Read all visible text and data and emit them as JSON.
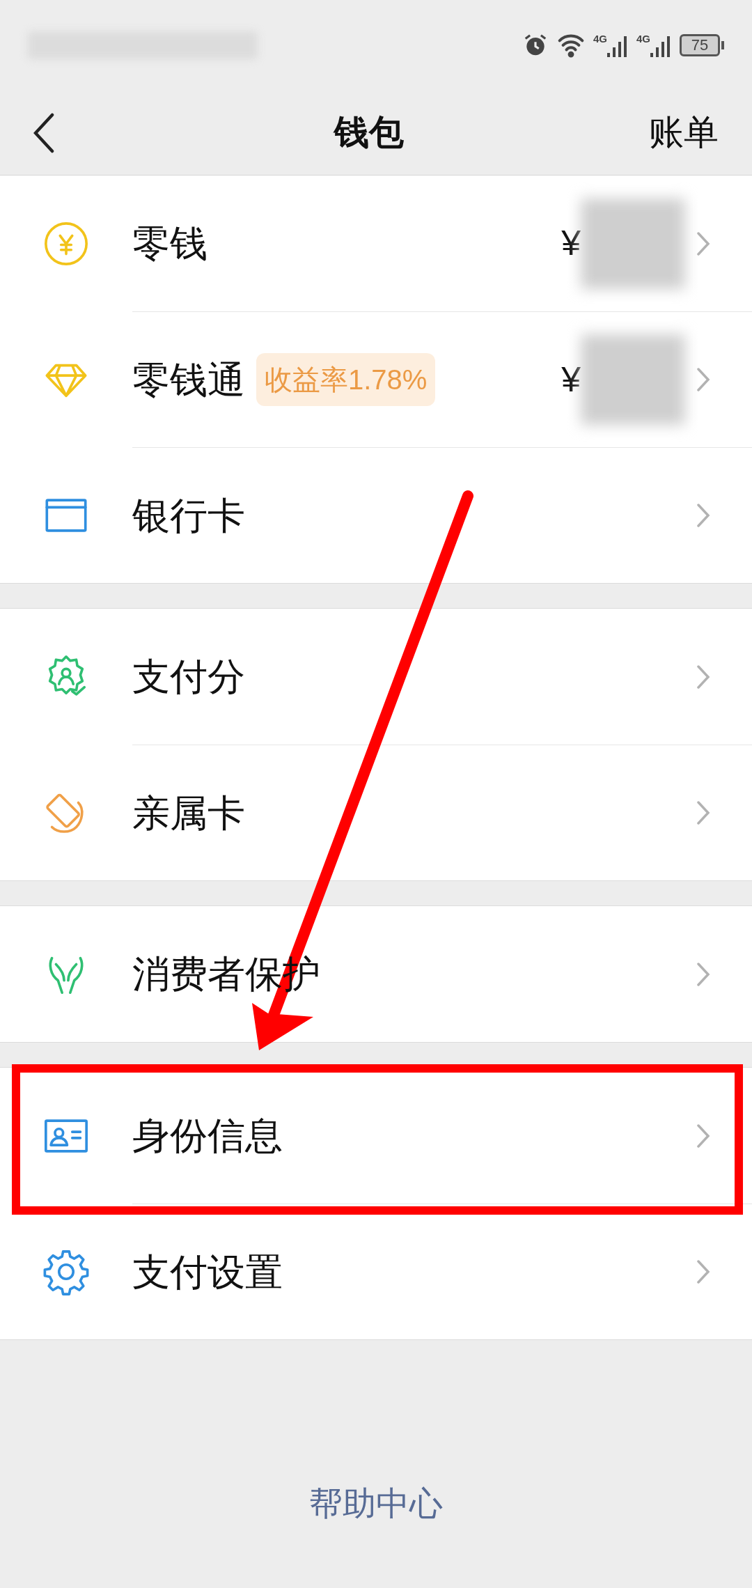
{
  "status_bar": {
    "network": [
      "4G",
      "4G"
    ],
    "battery": "75"
  },
  "nav": {
    "title": "钱包",
    "action": "账单"
  },
  "groups": [
    {
      "rows": [
        {
          "label": "零钱",
          "amount": "¥"
        },
        {
          "label": "零钱通",
          "badge": "收益率1.78%",
          "amount": "¥"
        },
        {
          "label": "银行卡"
        }
      ]
    },
    {
      "rows": [
        {
          "label": "支付分"
        },
        {
          "label": "亲属卡"
        }
      ]
    },
    {
      "rows": [
        {
          "label": "消费者保护"
        }
      ]
    },
    {
      "rows": [
        {
          "label": "身份信息"
        },
        {
          "label": "支付设置"
        }
      ]
    }
  ],
  "footer_link": "帮助中心"
}
